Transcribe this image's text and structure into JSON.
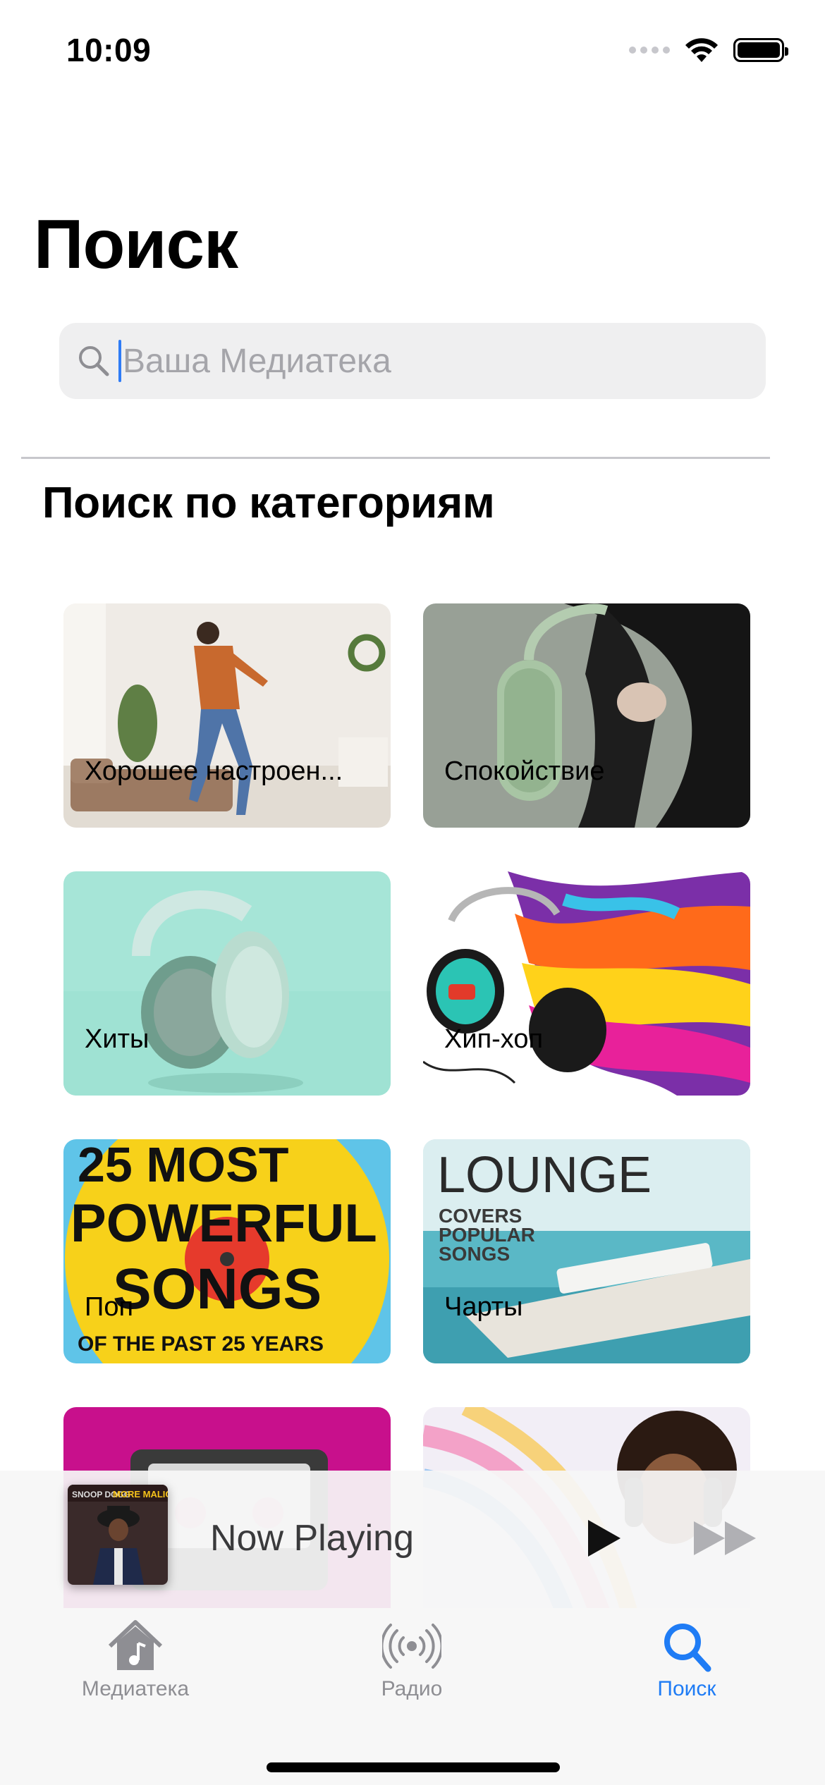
{
  "status_bar": {
    "time": "10:09"
  },
  "header": {
    "title": "Поиск"
  },
  "search": {
    "placeholder": "Ваша Медиатека",
    "value": ""
  },
  "section": {
    "title": "Поиск по категориям"
  },
  "categories": [
    {
      "label": "Хорошее настроен..."
    },
    {
      "label": "Спокойствие"
    },
    {
      "label": "Хиты"
    },
    {
      "label": "Хип-хоп"
    },
    {
      "label": "Поп"
    },
    {
      "label": "Чарты"
    },
    {
      "label": ""
    },
    {
      "label": ""
    }
  ],
  "tile_art_text": {
    "pop_cover": [
      "25 MOST",
      "POWERFUL",
      "SONGS",
      "OF THE PAST 25 YEARS"
    ],
    "lounge_cover": [
      "LOUNGE",
      "COVERS",
      "POPULAR",
      "SONGS"
    ]
  },
  "now_playing": {
    "title": "Now Playing",
    "cover_text": [
      "SNOOP DOGG",
      "MORE MALICE"
    ]
  },
  "tab_bar": {
    "tabs": [
      {
        "label": "Медиатека",
        "icon": "home-music-icon",
        "active": false
      },
      {
        "label": "Радио",
        "icon": "radio-broadcast-icon",
        "active": false
      },
      {
        "label": "Поиск",
        "icon": "search-icon",
        "active": true
      }
    ]
  },
  "colors": {
    "accent": "#1f7cf5",
    "inactive": "#8e8e93",
    "search_bg": "#efeff0"
  }
}
